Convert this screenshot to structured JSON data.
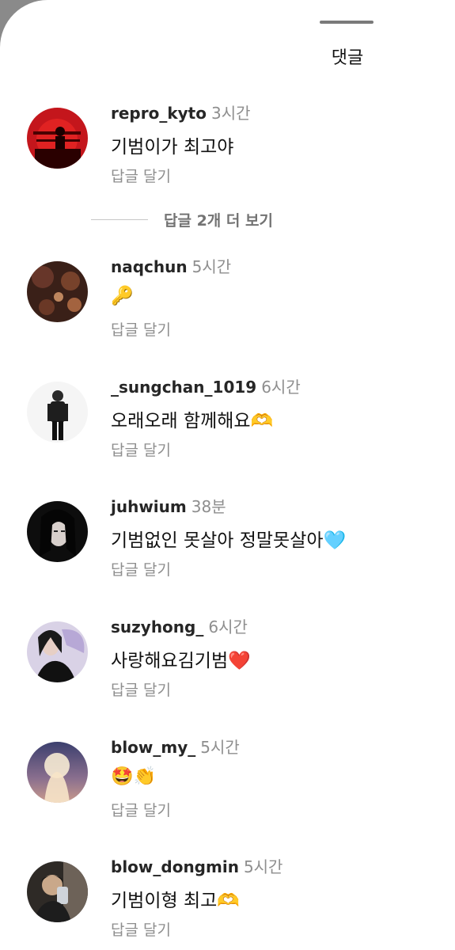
{
  "header": {
    "title": "댓글"
  },
  "thread_more": {
    "label": "답글 2개 더 보기"
  },
  "comments": [
    {
      "username": "repro_kyto",
      "time": "3시간",
      "text": "기범이가 최고야",
      "reply_label": "답글 달기"
    },
    {
      "username": "naqchun",
      "time": "5시간",
      "text": "🔑",
      "reply_label": "답글 달기"
    },
    {
      "username": "_sungchan_1019",
      "time": "6시간",
      "text": "오래오래 함께해요🫶",
      "reply_label": "답글 달기"
    },
    {
      "username": "juhwium",
      "time": "38분",
      "text": "기범없인 못살아 정말못살아🩵",
      "reply_label": "답글 달기"
    },
    {
      "username": "suzyhong_",
      "time": "6시간",
      "text": "사랑해요김기범❤️",
      "reply_label": "답글 달기"
    },
    {
      "username": "blow_my_",
      "time": "5시간",
      "text": "🤩👏",
      "reply_label": "답글 달기"
    },
    {
      "username": "blow_dongmin",
      "time": "5시간",
      "text": "기범이형 최고🫶",
      "reply_label": "답글 달기"
    }
  ]
}
